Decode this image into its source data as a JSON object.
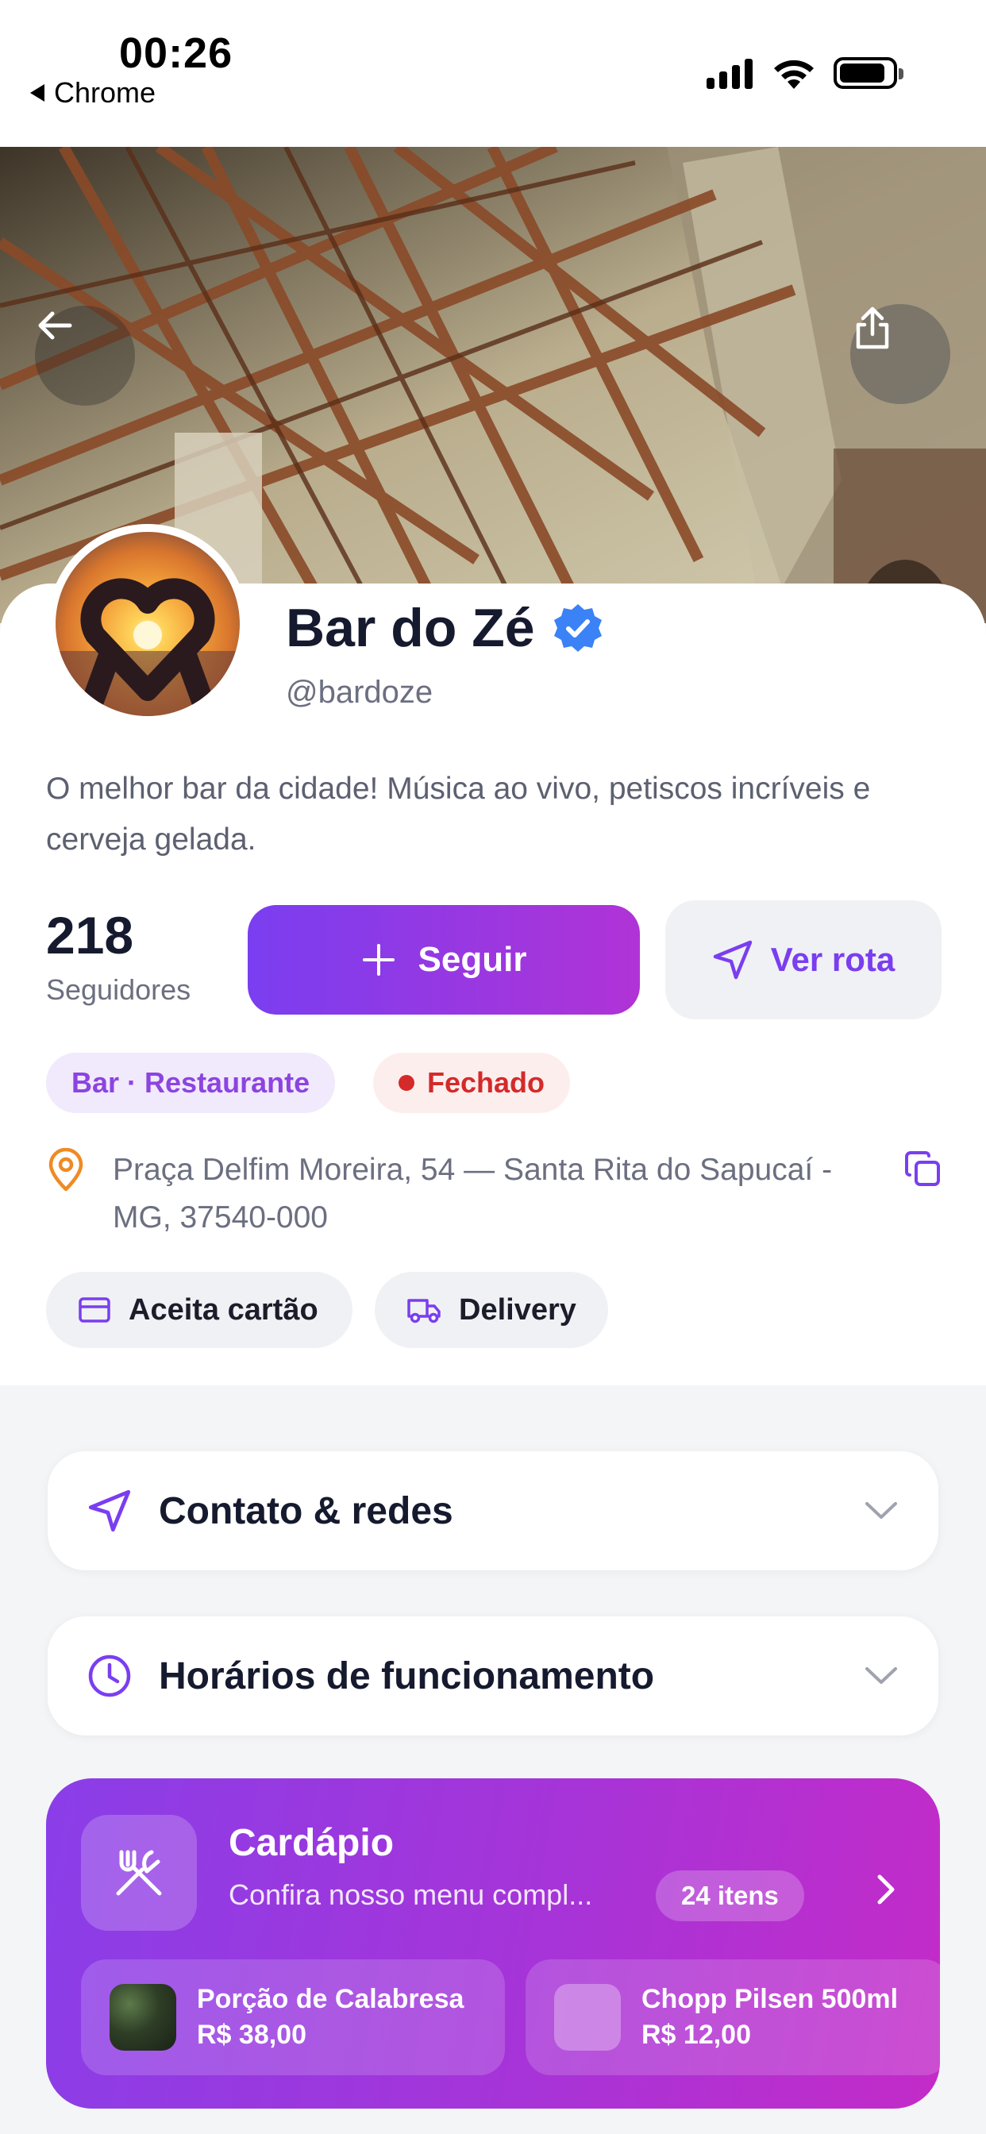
{
  "status_bar": {
    "time": "00:26",
    "back_app": "Chrome"
  },
  "profile": {
    "name": "Bar do Zé",
    "handle": "@bardoze",
    "bio": "O melhor bar da cidade! Música ao vivo, petiscos incríveis e cerveja gelada.",
    "followers_count": "218",
    "followers_label": "Seguidores",
    "follow_label": "Seguir",
    "route_label": "Ver rota",
    "category": "Bar · Restaurante",
    "status": "Fechado",
    "address": "Praça Delfim Moreira, 54 — Santa Rita do Sapucaí - MG, 37540-000",
    "features": [
      "Aceita cartão",
      "Delivery"
    ]
  },
  "sections": {
    "contact": "Contato & redes",
    "hours": "Horários de funcionamento"
  },
  "menu": {
    "title": "Cardápio",
    "subtitle": "Confira nosso menu compl...",
    "count": "24 itens",
    "items": [
      {
        "name": "Porção de Calabresa",
        "price": "R$ 38,00"
      },
      {
        "name": "Chopp Pilsen 500ml",
        "price": "R$ 12,00"
      }
    ]
  },
  "colors": {
    "accent": "#7a3ef0",
    "accent_end": "#c32bc8",
    "status_closed": "#d42a2a",
    "verified": "#3b82f6",
    "pin": "#f08a24"
  },
  "icons": {
    "back": "arrow-left-icon",
    "share": "share-icon",
    "verified": "verified-badge-icon",
    "follow": "plus-icon",
    "route": "navigation-arrow-icon",
    "location": "map-pin-icon",
    "copy": "copy-icon",
    "card": "credit-card-icon",
    "delivery": "truck-icon",
    "contact": "navigation-arrow-icon",
    "hours": "clock-icon",
    "menu": "fork-knife-icon",
    "chevron_down": "chevron-down-icon",
    "chevron_right": "chevron-right-icon"
  }
}
